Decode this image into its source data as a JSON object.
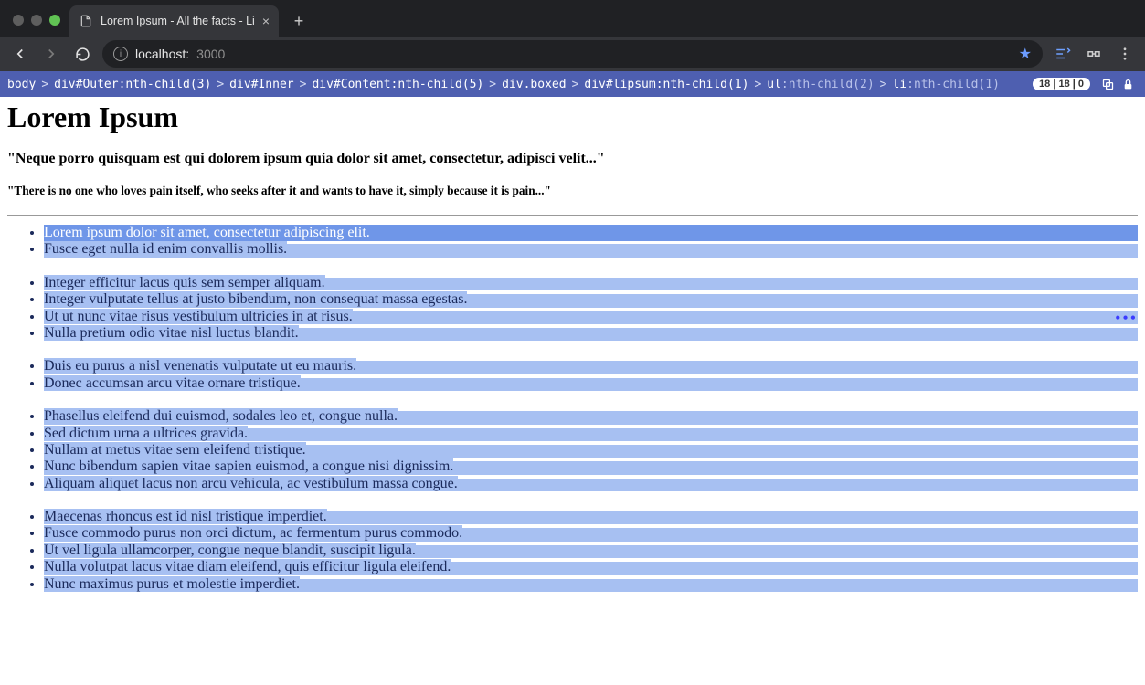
{
  "browser": {
    "tab_title": "Lorem Ipsum - All the facts - Li",
    "url_host": "localhost:",
    "url_port": "3000",
    "plus": "+"
  },
  "devbar": {
    "crumbs": [
      {
        "text": "body",
        "dim": false
      },
      {
        "text": "div#Outer:nth-child(3)",
        "dim": false
      },
      {
        "text": "div#Inner",
        "dim": false
      },
      {
        "text": "div#Content:nth-child(5)",
        "dim": false
      },
      {
        "text": "div.boxed",
        "dim": false
      },
      {
        "text": "div#lipsum:nth-child(1)",
        "dim": false
      },
      {
        "text": "ul:nth-child(2)",
        "dim": true
      },
      {
        "text": "li:nth-child(1)",
        "dim": true
      }
    ],
    "counter": "18 | 18 | 0"
  },
  "page": {
    "title": "Lorem Ipsum",
    "subtitle": "\"Neque porro quisquam est qui dolorem ipsum quia dolor sit amet, consectetur, adipisci velit...\"",
    "subtitle2": "\"There is no one who loves pain itself, who seeks after it and wants to have it, simply because it is pain...\"",
    "groups": [
      [
        "Lorem ipsum dolor sit amet, consectetur adipiscing elit.",
        "Fusce eget nulla id enim convallis mollis."
      ],
      [
        "Integer efficitur lacus quis sem semper aliquam.",
        "Integer vulputate tellus at justo bibendum, non consequat massa egestas.",
        "Ut ut nunc vitae risus vestibulum ultricies in at risus.",
        "Nulla pretium odio vitae nisl luctus blandit."
      ],
      [
        "Duis eu purus a nisl venenatis vulputate ut eu mauris.",
        "Donec accumsan arcu vitae ornare tristique."
      ],
      [
        "Phasellus eleifend dui euismod, sodales leo et, congue nulla.",
        "Sed dictum urna a ultrices gravida.",
        "Nullam at metus vitae sem eleifend tristique.",
        "Nunc bibendum sapien vitae sapien euismod, a congue nisi dignissim.",
        "Aliquam aliquet lacus non arcu vehicula, ac vestibulum massa congue."
      ],
      [
        "Maecenas rhoncus est id nisl tristique imperdiet.",
        "Fusce commodo purus non orci dictum, ac fermentum purus commodo.",
        "Ut vel ligula ullamcorper, congue neque blandit, suscipit ligula.",
        "Nulla volutpat lacus vitae diam eleifend, quis efficitur ligula eleifend.",
        "Nunc maximus purus et molestie imperdiet."
      ]
    ]
  }
}
